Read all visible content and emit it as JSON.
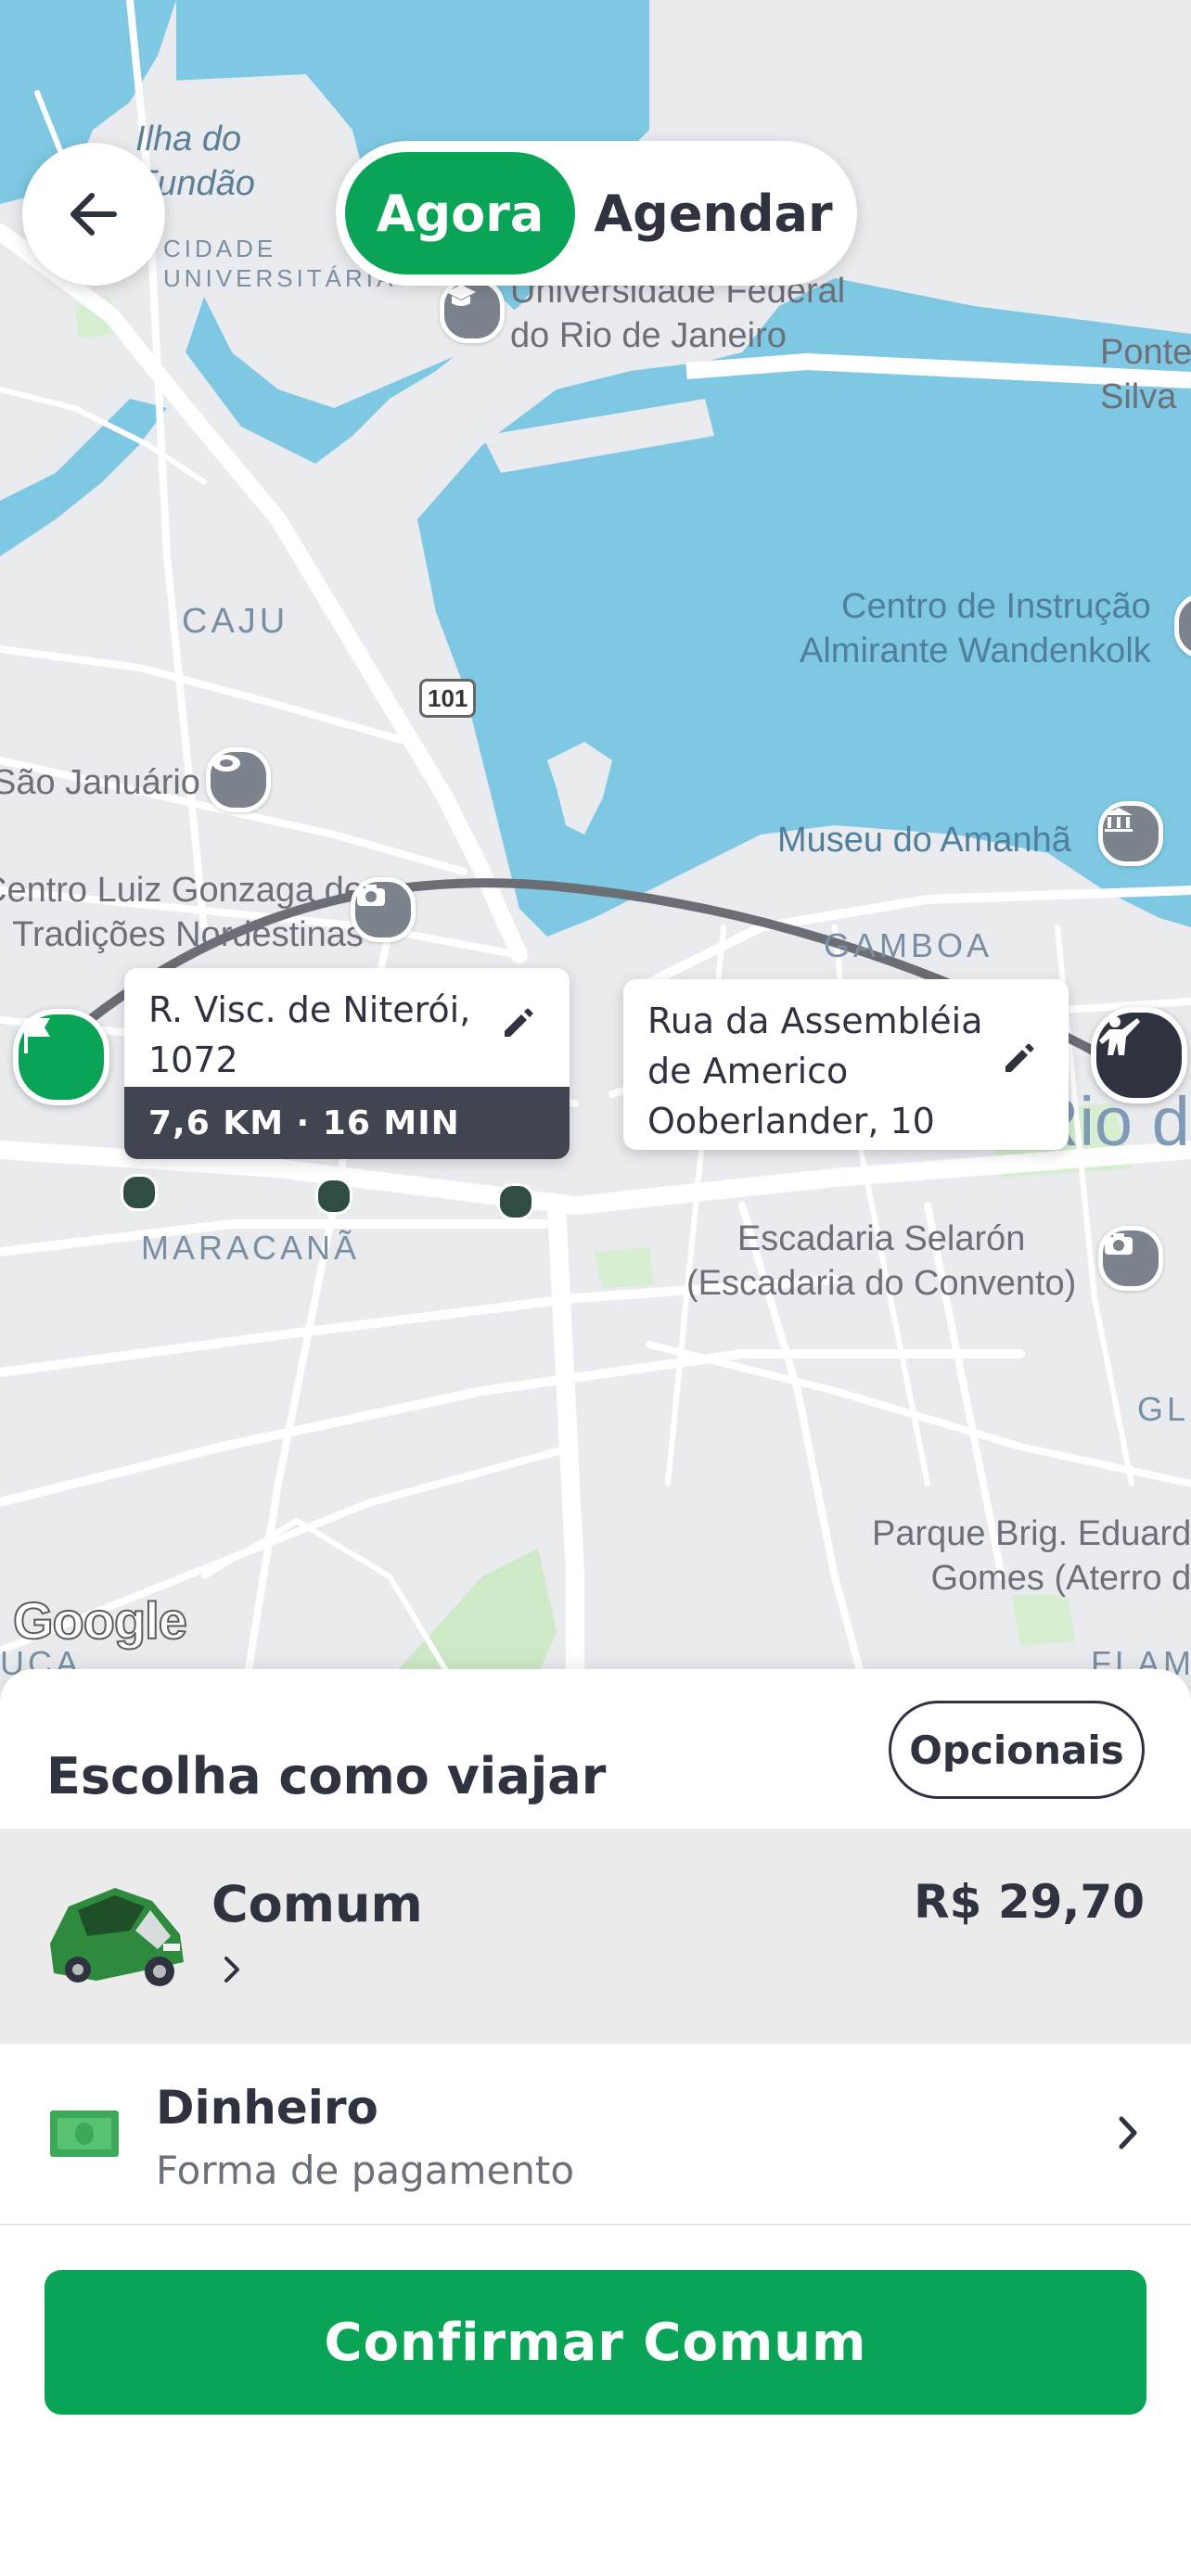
{
  "header": {
    "back_label": "Voltar",
    "toggle": {
      "active": "Agora",
      "inactive": "Agendar"
    }
  },
  "map": {
    "labels": [
      "Ilha do\nFundão",
      "CIDADE\nUNIVERSITÁRIA",
      "Universidade Federal\ndo Rio de Janeiro",
      "Ponte\nSilva",
      "CAJU",
      "101",
      "Centro de Instrução\nAlmirante Wandenkolk",
      "São Januário",
      "Museu do Amanhã",
      "Centro Luiz Gonzaga de\nTradições Nordestinas",
      "GAMBOA",
      "Rio de",
      "MARACANÃ",
      "Escadaria Selarón\n(Escadaria do Convento)",
      "GL",
      "Parque Brig. Eduardo\nGomes (Aterro do",
      "FLAM",
      "UCA"
    ],
    "attribution": "Google",
    "origin_bubble": {
      "address": "R. Visc. de Niterói,\n1072",
      "eta": "7,6 KM · 16 MIN"
    },
    "destination_bubble": {
      "address": "Rua da Assembléia\nde Americo\nOoberlander, 10"
    }
  },
  "sheet": {
    "title": "Escolha como viajar",
    "options_button": "Opcionais",
    "ride": {
      "name": "Comum",
      "price": "R$ 29,70"
    },
    "payment": {
      "method": "Dinheiro",
      "subtitle": "Forma de pagamento"
    },
    "confirm_button": "Confirmar Comum"
  },
  "colors": {
    "brand_green": "#0aa457",
    "water": "#7ec8e3",
    "land": "#e9ebef",
    "dark": "#2f3340"
  }
}
